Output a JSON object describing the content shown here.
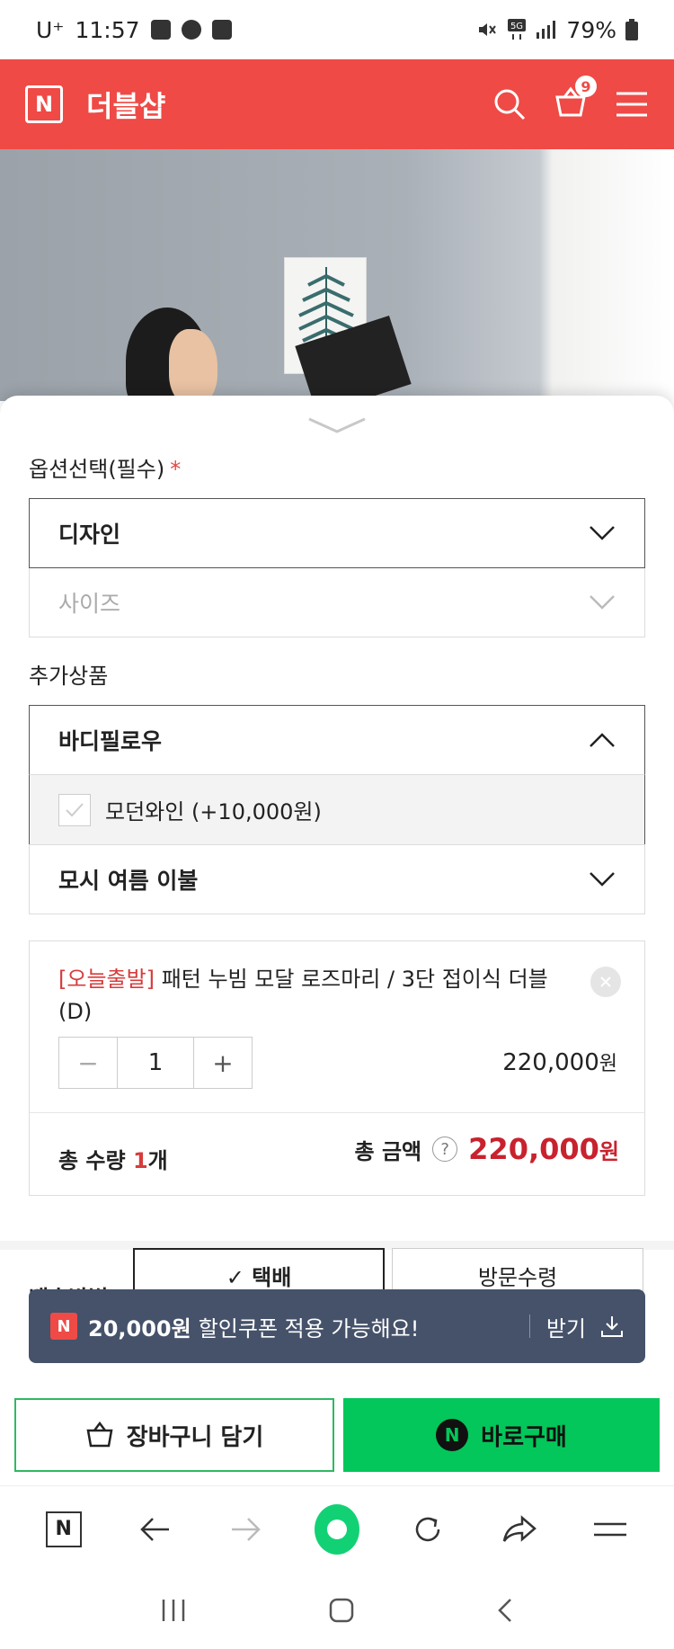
{
  "status_bar": {
    "carrier": "U⁺",
    "time": "11:57",
    "battery": "79%"
  },
  "app": {
    "title": "더블샵",
    "logo": "N",
    "cart_count": "9"
  },
  "option_section": {
    "label": "옵션선택(필수)",
    "required_mark": "*",
    "selects": [
      {
        "label": "디자인",
        "state": "active"
      },
      {
        "label": "사이즈",
        "state": "disabled"
      }
    ]
  },
  "addon_section": {
    "label": "추가상품",
    "groups": [
      {
        "label": "바디필로우",
        "expanded": true,
        "options": [
          {
            "label": "모던와인 (+10,000원)",
            "checked": false
          }
        ]
      },
      {
        "label": "모시 여름 이불",
        "expanded": false
      }
    ]
  },
  "selected_item": {
    "tag": "[오늘출발]",
    "name": "패턴 누빔 모달 로즈마리 / 3단 접이식 더블 (D)",
    "quantity": "1",
    "minus": "−",
    "plus": "+",
    "price": "220,000",
    "price_unit": "원"
  },
  "totals": {
    "qty_label": "총 수량",
    "qty_value": "1",
    "qty_unit": "개",
    "amount_label": "총 금액",
    "help": "?",
    "amount_value": "220,000",
    "amount_unit": "원"
  },
  "shipping": {
    "label": "배송방법",
    "options": [
      {
        "label": "✓ 택배",
        "selected": true
      },
      {
        "label": "방문수령",
        "selected": false
      }
    ]
  },
  "coupon_toast": {
    "badge": "N",
    "amount": "20,000원",
    "message": "할인쿠폰 적용 가능해요!",
    "action": "받기"
  },
  "buy_bar": {
    "cart_label": "장바구니 담기",
    "buy_label": "바로구매",
    "buy_badge": "N"
  },
  "browser_nav": {
    "logo": "N"
  },
  "colors": {
    "brand_red": "#ef4a46",
    "naver_green": "#03c75a",
    "price_red": "#c8222e",
    "toast_bg": "#45526a"
  }
}
